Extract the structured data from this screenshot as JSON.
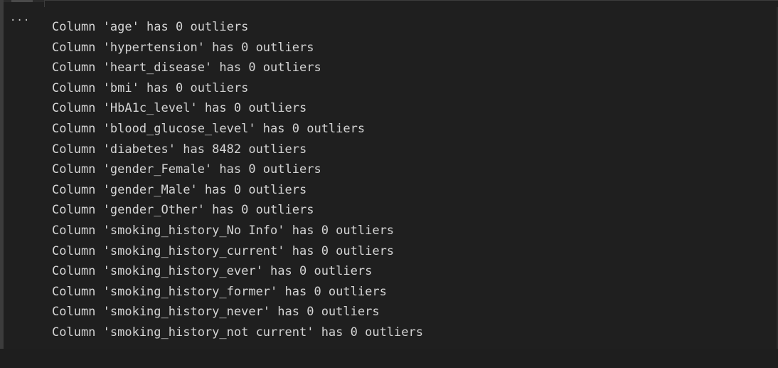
{
  "output": {
    "more_actions_glyph": "···",
    "lines": [
      "Column 'age' has 0 outliers",
      "Column 'hypertension' has 0 outliers",
      "Column 'heart_disease' has 0 outliers",
      "Column 'bmi' has 0 outliers",
      "Column 'HbA1c_level' has 0 outliers",
      "Column 'blood_glucose_level' has 0 outliers",
      "Column 'diabetes' has 8482 outliers",
      "Column 'gender_Female' has 0 outliers",
      "Column 'gender_Male' has 0 outliers",
      "Column 'gender_Other' has 0 outliers",
      "Column 'smoking_history_No Info' has 0 outliers",
      "Column 'smoking_history_current' has 0 outliers",
      "Column 'smoking_history_ever' has 0 outliers",
      "Column 'smoking_history_former' has 0 outliers",
      "Column 'smoking_history_never' has 0 outliers",
      "Column 'smoking_history_not current' has 0 outliers"
    ]
  }
}
